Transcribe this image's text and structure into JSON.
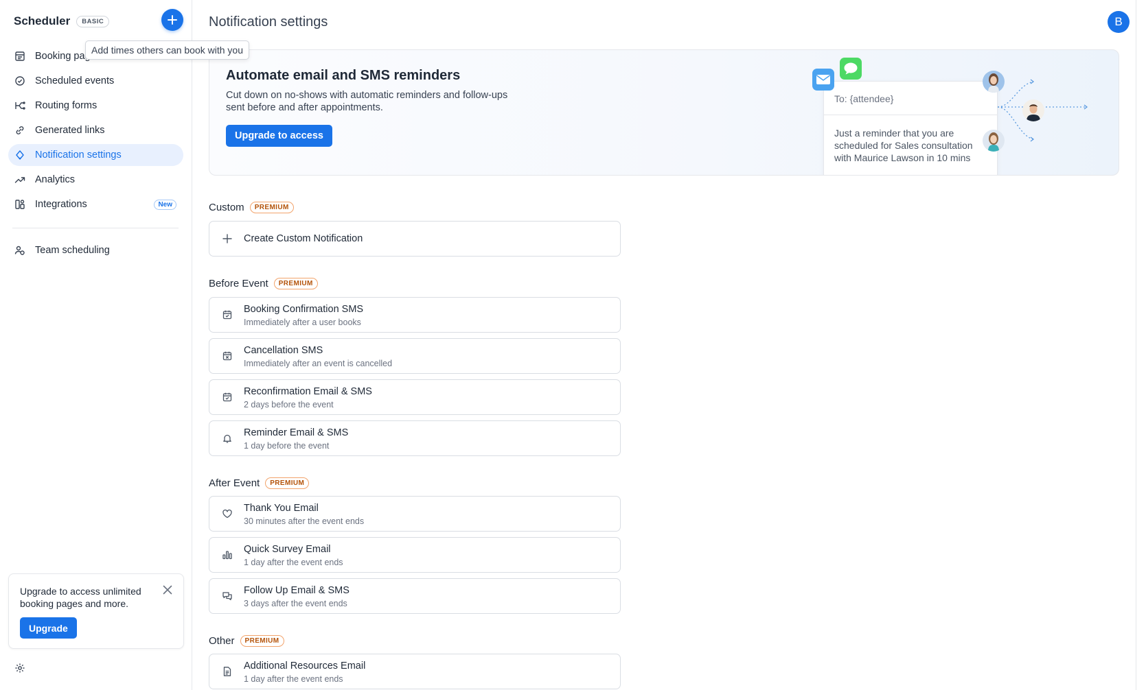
{
  "app": {
    "name": "Scheduler",
    "plan_badge": "BASIC",
    "add_tooltip": "Add times others can book with you"
  },
  "sidebar": {
    "items": [
      {
        "label": "Booking pages",
        "icon": "booking-icon"
      },
      {
        "label": "Scheduled events",
        "icon": "check-circle-icon"
      },
      {
        "label": "Routing forms",
        "icon": "routing-icon"
      },
      {
        "label": "Generated links",
        "icon": "link-icon"
      },
      {
        "label": "Notification settings",
        "icon": "bell-icon",
        "active": true
      },
      {
        "label": "Analytics",
        "icon": "trend-icon"
      },
      {
        "label": "Integrations",
        "icon": "integrations-icon",
        "badge": "New"
      }
    ],
    "team": {
      "label": "Team scheduling",
      "icon": "team-icon"
    },
    "upgrade_card": {
      "message": "Upgrade to access unlimited booking pages and more.",
      "button": "Upgrade"
    }
  },
  "header": {
    "title": "Notification settings",
    "avatar_initial": "B"
  },
  "banner": {
    "title": "Automate email and SMS reminders",
    "description": "Cut down on no-shows with automatic reminders and follow-ups sent before and after appointments.",
    "button": "Upgrade to access",
    "mock_to": "To: {attendee}",
    "mock_body": "Just a reminder that you are scheduled for Sales consultation with Maurice Lawson in 10 mins"
  },
  "sections": {
    "custom": {
      "label": "Custom",
      "badge": "PREMIUM",
      "create_label": "Create Custom Notification"
    },
    "before": {
      "label": "Before Event",
      "badge": "PREMIUM",
      "items": [
        {
          "title": "Booking Confirmation SMS",
          "sub": "Immediately after a user books",
          "icon": "calendar-check-icon"
        },
        {
          "title": "Cancellation SMS",
          "sub": "Immediately after an event is cancelled",
          "icon": "calendar-x-icon"
        },
        {
          "title": "Reconfirmation Email & SMS",
          "sub": "2 days before the event",
          "icon": "calendar-check-icon"
        },
        {
          "title": "Reminder Email & SMS",
          "sub": "1 day before the event",
          "icon": "bell-icon"
        }
      ]
    },
    "after": {
      "label": "After Event",
      "badge": "PREMIUM",
      "items": [
        {
          "title": "Thank You Email",
          "sub": "30 minutes after the event ends",
          "icon": "heart-icon"
        },
        {
          "title": "Quick Survey Email",
          "sub": "1 day after the event ends",
          "icon": "bar-chart-icon"
        },
        {
          "title": "Follow Up Email & SMS",
          "sub": "3 days after the event ends",
          "icon": "chat-icon"
        }
      ]
    },
    "other": {
      "label": "Other",
      "badge": "PREMIUM",
      "items": [
        {
          "title": "Additional Resources Email",
          "sub": "1 day after the event ends",
          "icon": "document-icon"
        }
      ]
    }
  },
  "colors": {
    "accent": "#1a73e8",
    "active_bg": "#e8f0fe",
    "premium": "#b45309"
  }
}
